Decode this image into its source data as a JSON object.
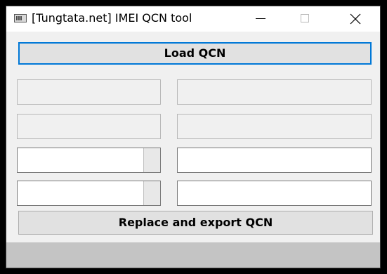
{
  "window": {
    "title": "[Tungtata.net] IMEI QCN tool",
    "icon": "app-window-icon"
  },
  "caption_buttons": {
    "minimize_icon": "minimize-icon",
    "maximize_icon": "maximize-icon",
    "close_icon": "close-icon"
  },
  "buttons": {
    "load_label": "Load QCN",
    "export_label": "Replace and export QCN"
  },
  "fields": {
    "row1_left": {
      "value": "",
      "enabled": false
    },
    "row1_right": {
      "value": "",
      "enabled": false
    },
    "row2_left": {
      "value": "",
      "enabled": false
    },
    "row2_right": {
      "value": "",
      "enabled": false
    },
    "row3_left": {
      "value": "",
      "enabled": true
    },
    "row3_right": {
      "value": "",
      "enabled": true
    },
    "row4_left": {
      "value": "",
      "enabled": true
    },
    "row4_right": {
      "value": "",
      "enabled": true
    }
  },
  "colors": {
    "focus_border": "#0078d7",
    "client_background": "#f0f0f0",
    "status_bar": "#c4c4c4"
  }
}
